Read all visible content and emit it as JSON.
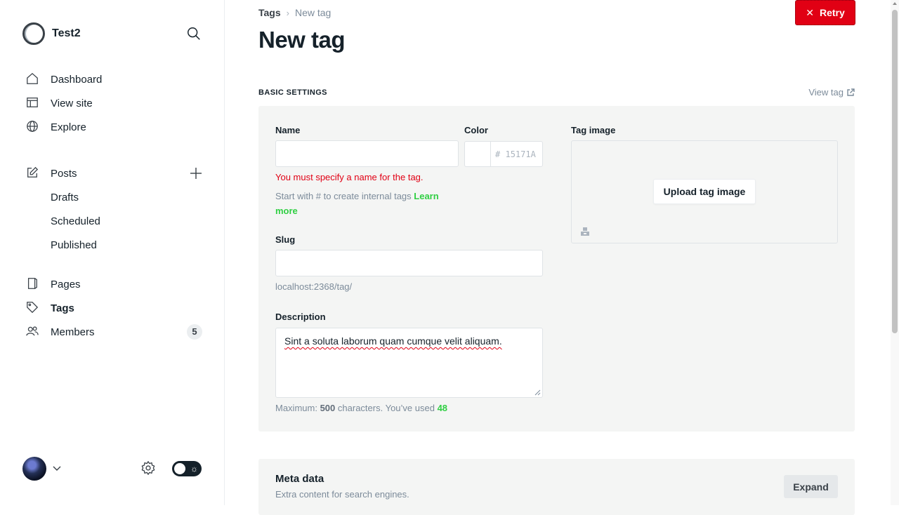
{
  "brand": {
    "name": "Test2"
  },
  "nav": {
    "dashboard": "Dashboard",
    "view_site": "View site",
    "explore": "Explore",
    "posts": "Posts",
    "drafts": "Drafts",
    "scheduled": "Scheduled",
    "published": "Published",
    "pages": "Pages",
    "tags": "Tags",
    "members": "Members",
    "members_count": "5"
  },
  "breadcrumb": {
    "parent": "Tags",
    "current": "New tag"
  },
  "page": {
    "title": "New tag"
  },
  "retry_button": {
    "label": "Retry"
  },
  "basic_settings": {
    "section_title": "BASIC SETTINGS",
    "view_tag_label": "View tag",
    "name_label": "Name",
    "name_value": "",
    "name_error": "You must specify a name for the tag.",
    "hint_text": "Start with # to create internal tags",
    "learn_more": "Learn more",
    "color_label": "Color",
    "color_hash": "#",
    "color_placeholder": "15171A",
    "tag_image_label": "Tag image",
    "upload_label": "Upload tag image",
    "slug_label": "Slug",
    "slug_value": "",
    "slug_url": "localhost:2368/tag/",
    "description_label": "Description",
    "description_value": "Sint a soluta laborum quam cumque velit aliquam.",
    "counter_prefix": "Maximum:",
    "counter_max": "500",
    "counter_middle": "characters. You’ve used",
    "counter_used": "48"
  },
  "meta_data": {
    "title": "Meta data",
    "subtitle": "Extra content for search engines.",
    "expand_label": "Expand"
  },
  "colors": {
    "accent_green": "#30cf43",
    "error_red": "#e10014",
    "text_dark": "#15212a",
    "muted": "#7c8b9a"
  }
}
